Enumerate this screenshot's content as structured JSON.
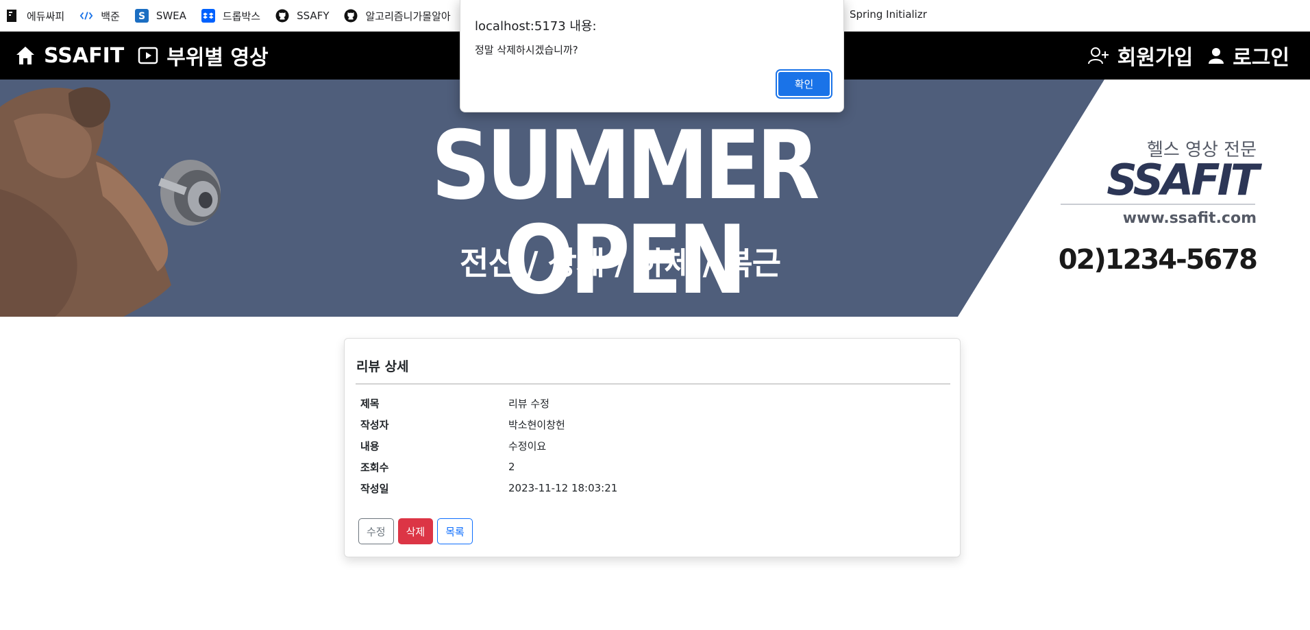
{
  "bookmarks": [
    {
      "label": "에듀싸피",
      "icon": "edussafy-icon"
    },
    {
      "label": "백준",
      "icon": "code-brackets-icon"
    },
    {
      "label": "SWEA",
      "icon": "swea-icon"
    },
    {
      "label": "드롭박스",
      "icon": "dropbox-icon"
    },
    {
      "label": "SSAFY",
      "icon": "github-icon"
    },
    {
      "label": "알고리즘니가몰알아",
      "icon": "github-icon"
    }
  ],
  "bookmark_right": "Spring Initializr",
  "navbar": {
    "brand": "SSAFIT",
    "videos": "부위별 영상",
    "signup": "회원가입",
    "login": "로그인"
  },
  "banner": {
    "headline": "SUMMER OPEN",
    "subline": "전신 / 상체 / 하체 / 복근",
    "kicker": "헬스 영상 전문",
    "logo": "SSAFIT",
    "url": "www.ssafit.com",
    "phone": "02)1234-5678"
  },
  "review": {
    "title": "리뷰 상세",
    "rows": [
      {
        "label": "제목",
        "value": "리뷰 수정"
      },
      {
        "label": "작성자",
        "value": "박소현이창헌"
      },
      {
        "label": "내용",
        "value": "수정이요"
      },
      {
        "label": "조회수",
        "value": "2"
      },
      {
        "label": "작성일",
        "value": "2023-11-12 18:03:21"
      }
    ],
    "buttons": {
      "edit": "수정",
      "delete": "삭제",
      "list": "목록"
    }
  },
  "dialog": {
    "title": "localhost:5173 내용:",
    "message": "정말 삭제하시겠습니까?",
    "ok": "확인"
  },
  "colors": {
    "navbar": "#000000",
    "banner": "#4f5e7b",
    "danger": "#dc3545",
    "primary": "#0d6efd",
    "dialog_button": "#1a73e8"
  }
}
